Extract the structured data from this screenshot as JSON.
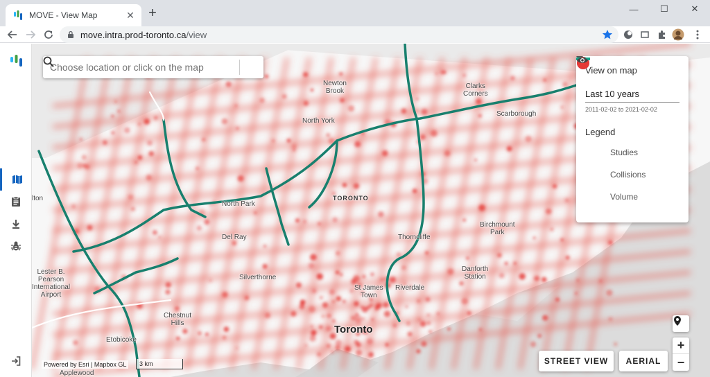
{
  "browser": {
    "tab_title": "MOVE - View Map",
    "url_host": "move.intra.prod-toronto.ca",
    "url_path": "/view"
  },
  "search": {
    "placeholder": "Choose location or click on the map"
  },
  "panel": {
    "title": "View on map",
    "selected_range": "Last 10 years",
    "date_range": "2011-02-02 to 2021-02-02",
    "legend_title": "Legend",
    "legend": [
      {
        "label": "Studies",
        "color": "#8b6cf0"
      },
      {
        "label": "Collisions",
        "color": "#e53935"
      },
      {
        "label": "Volume",
        "color": "#18a488"
      }
    ]
  },
  "map": {
    "labels": [
      "Newton\nBrook",
      "Clarks\nCorners",
      "North York",
      "Scarborough",
      "TORONTO",
      "North Park",
      "Birchmount\nPark",
      "Del Ray",
      "Thorncliffe",
      "Danforth\nStation",
      "Lester B.\nPearson\nInternational\nAirport",
      "Silverthorne",
      "St James\nTown",
      "Riverdale",
      "Chestnut\nHills",
      "Toronto",
      "Etobicoke",
      "Applewood",
      "lton"
    ],
    "street_view_label": "STREET VIEW",
    "aerial_label": "AERIAL",
    "attribution": "Powered by Esri | Mapbox GL",
    "scale_label": "3 km",
    "zoom_in": "+",
    "zoom_out": "−"
  },
  "colors": {
    "accent": "#1565c0",
    "collision": "#e53935",
    "volume": "#18806e",
    "studies": "#8b6cf0"
  }
}
